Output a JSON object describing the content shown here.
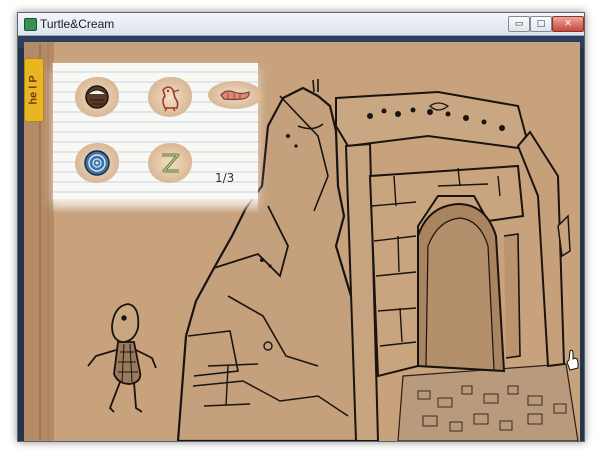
{
  "window": {
    "title": "Turtle&Cream",
    "buttons": {
      "minimize": "▭",
      "maximize": "□",
      "close": "✕"
    }
  },
  "game": {
    "help_tab_label": "he l P",
    "inventory": {
      "items": [
        {
          "name": "coconut-icon"
        },
        {
          "name": "bird-drawing-icon"
        },
        {
          "name": "worm-icon"
        },
        {
          "name": "blue-shell-icon"
        },
        {
          "name": "z-rune-icon"
        }
      ],
      "counter": "1/3"
    },
    "colors": {
      "cardboard": "#c7a17c",
      "ink": "#1a1410",
      "help_tab": "#e9b623"
    }
  }
}
